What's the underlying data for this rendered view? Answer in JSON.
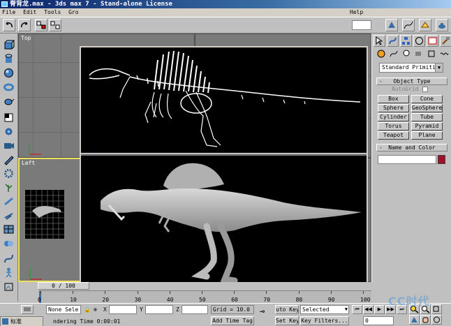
{
  "window": {
    "title": "脊背龙.max - 3ds max 7 - Stand-alone License"
  },
  "menu": [
    "File",
    "Edit",
    "Tools",
    "Gro",
    "Help"
  ],
  "viewports": {
    "top_label": "Top",
    "left_label": "Left"
  },
  "command_panel": {
    "primitive_dropdown": "Standard Primitiv",
    "object_type_header": "Object Type",
    "autogrid_label": "AutoGrid",
    "object_buttons": [
      "Box",
      "Cone",
      "Sphere",
      "GeoSphere",
      "Cylinder",
      "Tube",
      "Torus",
      "Pyramid",
      "Teapot",
      "Plane"
    ],
    "name_color_header": "Name and Color"
  },
  "timeline": {
    "slider_label": "0 / 100",
    "ticks": [
      "0",
      "10",
      "20",
      "30",
      "40",
      "50",
      "60",
      "70",
      "80",
      "90",
      "100"
    ]
  },
  "status": {
    "selection": "None Sele",
    "x_label": "X",
    "y_label": "Y",
    "z_label": "Z",
    "grid": "Grid = 10.0",
    "auto_key": "uto Key",
    "selected_dropdown": "Selected",
    "set_key": "Set Key",
    "key_filters": "Key Filters...",
    "rendering_time": "ndering Time  0:00:01",
    "add_time_tag": "Add Time Tag",
    "frame_value": "0",
    "ime_label": "标准"
  },
  "watermark": "CC时代",
  "colors": {
    "accent": "#0a246a",
    "name_swatch": "#a0102a",
    "active_viewport_border": "#f0e060"
  }
}
